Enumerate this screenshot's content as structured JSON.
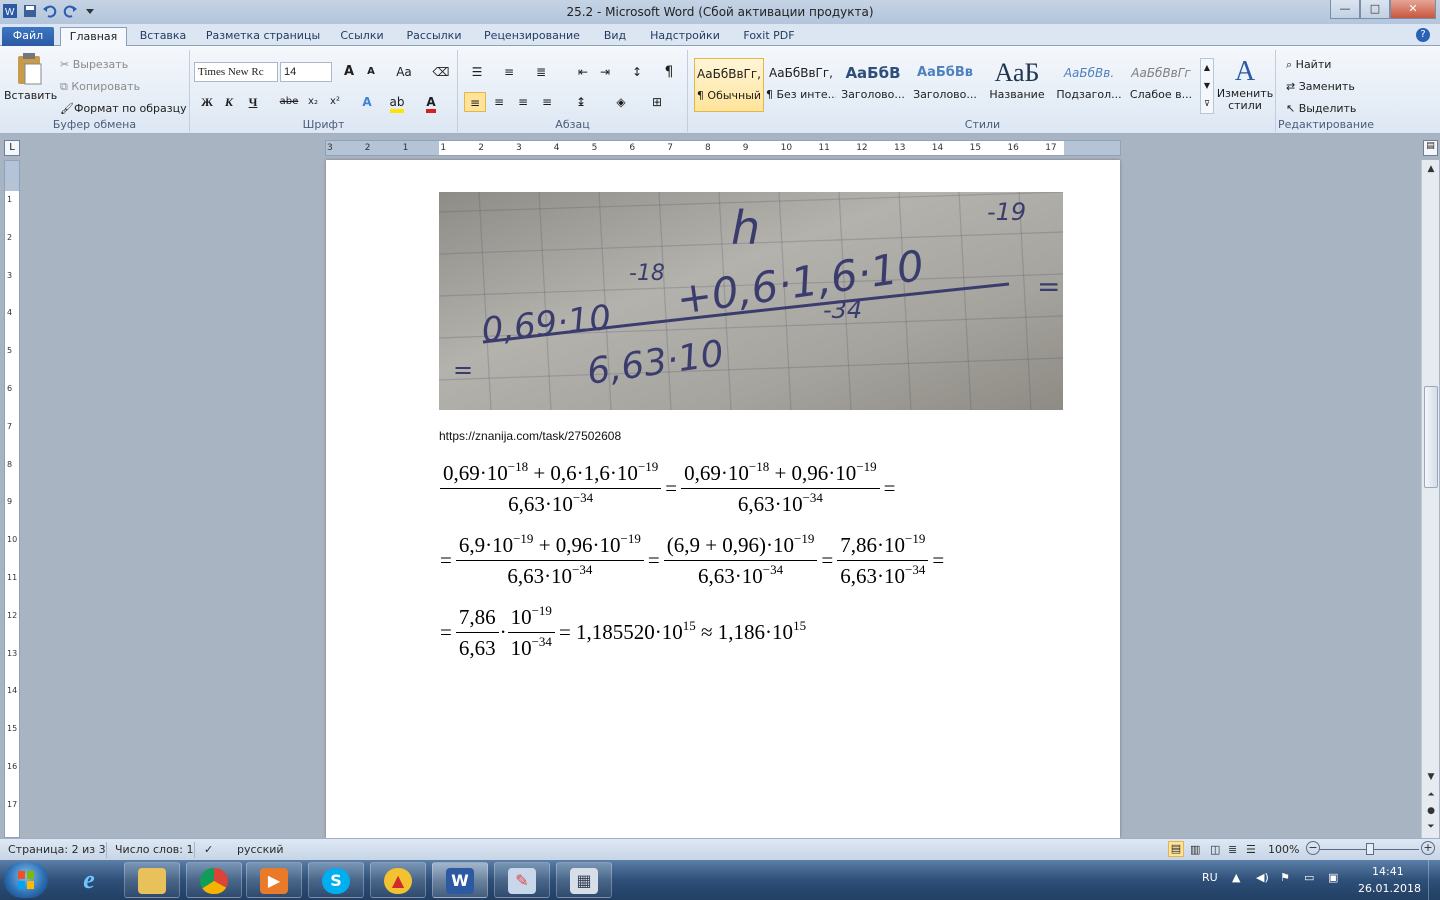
{
  "window": {
    "title": "25.2  -  Microsoft Word (Сбой активации продукта)",
    "min": "—",
    "max": "□",
    "close": "✕"
  },
  "tabs": [
    "Файл",
    "Главная",
    "Вставка",
    "Разметка страницы",
    "Ссылки",
    "Рассылки",
    "Рецензирование",
    "Вид",
    "Надстройки",
    "Foxit PDF"
  ],
  "clipboard": {
    "paste": "Вставить",
    "cut": "Вырезать",
    "copy": "Копировать",
    "format_painter": "Формат по образцу",
    "label": "Буфер обмена"
  },
  "font": {
    "name": "Times New Rc",
    "size": "14",
    "bold": "Ж",
    "italic": "К",
    "underline": "Ч",
    "strike": "abe",
    "sub": "x₂",
    "sup": "x²",
    "grow": "A",
    "shrink": "A",
    "case": "Aa",
    "label": "Шрифт"
  },
  "paragraph": {
    "label": "Абзац",
    "pilcrow": "¶"
  },
  "styles": {
    "label": "Стили",
    "items": [
      {
        "sample": "АаБбВвГг,",
        "name": "¶ Обычный"
      },
      {
        "sample": "АаБбВвГг,",
        "name": "¶ Без инте..."
      },
      {
        "sample": "АаБбВ",
        "name": "Заголово..."
      },
      {
        "sample": "АаБбВв",
        "name": "Заголово..."
      },
      {
        "sample": "АаБ",
        "name": "Название"
      },
      {
        "sample": "АаБбВв.",
        "name": "Подзагол..."
      },
      {
        "sample": "АаБбВвГг",
        "name": "Слабое в..."
      }
    ],
    "change": "Изменить стили"
  },
  "editing": {
    "label": "Редактирование",
    "find": "Найти",
    "replace": "Заменить",
    "select": "Выделить"
  },
  "ruler_numbers": [
    "3",
    "2",
    "1",
    "1",
    "2",
    "3",
    "4",
    "5",
    "6",
    "7",
    "8",
    "9",
    "10",
    "11",
    "12",
    "13",
    "14",
    "15",
    "16",
    "17"
  ],
  "vruler_numbers": [
    "1",
    "2",
    "3",
    "4",
    "5",
    "6",
    "7",
    "8",
    "9",
    "10",
    "11",
    "12",
    "13",
    "14",
    "15",
    "16",
    "17"
  ],
  "document": {
    "link": "https://znanija.com/task/27502608",
    "photo_text": {
      "h": "h",
      "num": "0,69·10",
      "exp18": "-18",
      "plus": "+0,6·1,6·10",
      "exp19": "-19",
      "den": "6,63·10",
      "exp34": "-34",
      "eq": "="
    },
    "line1": {
      "n1": "0,69·10",
      "n1e": "−18",
      "n1b": " + 0,6·1,6·10",
      "n1be": "−19",
      "d1": "6,63·10",
      "d1e": "−34",
      "n2": "0,69·10",
      "n2e": "−18",
      "n2b": " + 0,96·10",
      "n2be": "−19",
      "d2": "6,63·10",
      "d2e": "−34",
      "eq": "="
    },
    "line2": {
      "n1": "6,9·10",
      "n1e": "−19",
      "n1b": " + 0,96·10",
      "n1be": "−19",
      "d1": "6,63·10",
      "d1e": "−34",
      "n2": "(6,9 + 0,96)·10",
      "n2e": "−19",
      "d2": "6,63·10",
      "d2e": "−34",
      "n3": "7,86·10",
      "n3e": "−19",
      "d3": "6,63·10",
      "d3e": "−34",
      "eq": "="
    },
    "line3": {
      "n1": "7,86",
      "d1": "6,63",
      "dot": "·",
      "n2": "10",
      "n2e": "−19",
      "d2": "10",
      "d2e": "−34",
      "r1": "= 1,185520·10",
      "r1e": "15",
      "r2": " ≈ 1,186·10",
      "r2e": "15",
      "eq": "="
    }
  },
  "status": {
    "page": "Страница: 2 из 3",
    "words": "Число слов: 1",
    "lang": "русский",
    "zoom": "100%",
    "zoom_minus": "−",
    "zoom_plus": "+"
  },
  "taskbar": {
    "lang": "RU",
    "time": "14:41",
    "date": "26.01.2018",
    "apps": [
      "ie-icon",
      "explorer-icon",
      "chrome-icon",
      "media-player-icon",
      "skype-icon",
      "app-triangle-icon",
      "word-icon",
      "paint-icon",
      "calculator-icon"
    ]
  },
  "colors": {
    "accent": "#2b5aa3",
    "taskbar": "#2e4f78",
    "page": "#ffffff"
  }
}
